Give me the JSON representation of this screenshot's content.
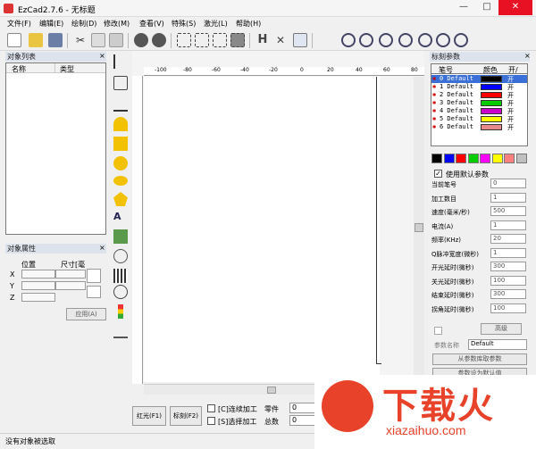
{
  "window": {
    "title": "EzCad2.7.6 - 无标题",
    "controls": [
      "—",
      "□",
      "✕"
    ]
  },
  "menu": [
    "文件(F)",
    "编辑(E)",
    "绘制(D)",
    "修改(M)",
    "查看(V)",
    "特殊(S)",
    "激光(L)",
    "帮助(H)"
  ],
  "object_list": {
    "title": "对象列表",
    "col_name": "名称",
    "col_type": "类型"
  },
  "object_props": {
    "title": "对象属性",
    "pos_label": "位置",
    "size_label": "尺寸[毫",
    "x": "X",
    "y": "Y",
    "z": "Z",
    "apply": "应用(A)"
  },
  "ruler": {
    "h_ticks": [
      "-100",
      "-80",
      "-60",
      "-40",
      "-20",
      "0",
      "20",
      "40",
      "60",
      "80"
    ]
  },
  "bottom": {
    "red_light": "红光(F1)",
    "mark": "标刻(F2)",
    "continuous": "[C]连续加工",
    "selected": "[S]选择加工",
    "parts_label": "零件",
    "parts_value": "0",
    "total_label": "总数",
    "total_value": "0"
  },
  "mark_params": {
    "title": "标刻参数",
    "cols": [
      "笔号",
      "颜色",
      "开/"
    ],
    "pens": [
      {
        "name": "0 Default",
        "color": "#000000",
        "on": "开"
      },
      {
        "name": "1 Default",
        "color": "#0000ff",
        "on": "开"
      },
      {
        "name": "2 Default",
        "color": "#ff0000",
        "on": "开"
      },
      {
        "name": "3 Default",
        "color": "#00cc00",
        "on": "开"
      },
      {
        "name": "4 Default",
        "color": "#cc00cc",
        "on": "开"
      },
      {
        "name": "5 Default",
        "color": "#ffff00",
        "on": "开"
      },
      {
        "name": "6 Default",
        "color": "#e88a8a",
        "on": "开"
      }
    ],
    "palette": [
      "#000000",
      "#0000ff",
      "#ff0000",
      "#00cc00",
      "#ff00ff",
      "#ffff00",
      "#ff8080",
      "#c0c0c0"
    ],
    "use_default": "使用默认参数",
    "params": [
      {
        "label": "当前笔号",
        "value": "0"
      },
      {
        "label": "加工数目",
        "value": "1"
      },
      {
        "label": "速度(毫米/秒)",
        "value": "500"
      },
      {
        "label": "电流(A)",
        "value": "1"
      },
      {
        "label": "频率(KHz)",
        "value": "20"
      },
      {
        "label": "Q脉冲宽度(微秒)",
        "value": "1"
      },
      {
        "label": "开光延时(微秒)",
        "value": "300"
      },
      {
        "label": "关光延时(微秒)",
        "value": "100"
      },
      {
        "label": "结束延时(微秒)",
        "value": "300"
      },
      {
        "label": "拐角延时(微秒)",
        "value": "100"
      }
    ],
    "advanced": "高级",
    "param_name_label": "参数名称",
    "param_name_value": "Default",
    "from_lib": "从参数库取参数",
    "set_default": "参数设为默认值"
  },
  "status": "没有对象被选取",
  "watermark": {
    "text": "下载火",
    "sub": "xiazaihuo.com"
  }
}
